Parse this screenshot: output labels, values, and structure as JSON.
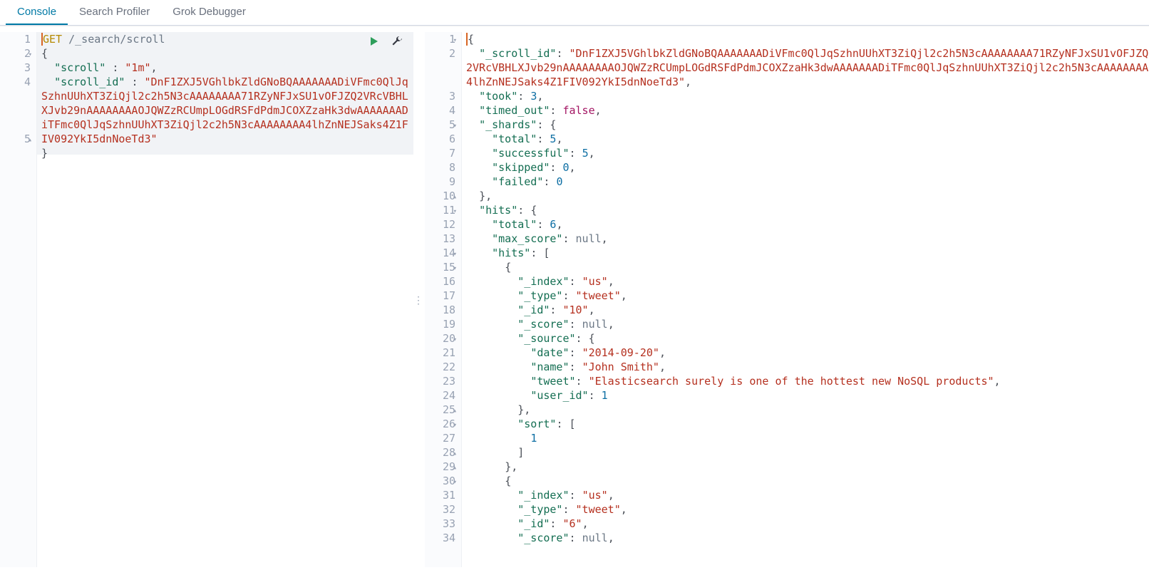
{
  "tabs": [
    {
      "label": "Console",
      "active": true
    },
    {
      "label": "Search Profiler",
      "active": false
    },
    {
      "label": "Grok Debugger",
      "active": false
    }
  ],
  "icons": {
    "play": "play-icon",
    "wrench": "wrench-icon",
    "resize": "resize-handle-icon"
  },
  "request": {
    "method": "GET",
    "path": "/_search/scroll",
    "body": {
      "scroll": "1m",
      "scroll_id": "DnF1ZXJ5VGhlbkZldGNoBQAAAAAAADiVFmc0QlJqSzhnUUhXT3ZiQjl2c2h5N3cAAAAAAAA71RZyNFJxSU1vOFJZQ2VRcVBHLXJvb29nAAAAAAAAOJQWZzRCUmpLOGdRSFdPdmJCOXZzaHk3dwAAAAAAADiTFmc0QlJqSzhnUUhXT3ZiQjl2c2h5N3cAAAAAAAA4lhZnNEJSaks4Z1FIV092YkI5dnNoeTd3"
    },
    "gutter": [
      {
        "n": "1",
        "fold": ""
      },
      {
        "n": "2",
        "fold": "▾"
      },
      {
        "n": "3",
        "fold": ""
      },
      {
        "n": "4",
        "fold": ""
      },
      {
        "n": "5",
        "fold": "▴"
      }
    ],
    "extra_line_slots": 3
  },
  "response": {
    "gutter": [
      {
        "n": "1",
        "fold": "▾"
      },
      {
        "n": "2",
        "fold": ""
      },
      {
        "n": "3",
        "fold": ""
      },
      {
        "n": "4",
        "fold": ""
      },
      {
        "n": "5",
        "fold": "▾"
      },
      {
        "n": "6",
        "fold": ""
      },
      {
        "n": "7",
        "fold": ""
      },
      {
        "n": "8",
        "fold": ""
      },
      {
        "n": "9",
        "fold": ""
      },
      {
        "n": "10",
        "fold": "▴"
      },
      {
        "n": "11",
        "fold": "▾"
      },
      {
        "n": "12",
        "fold": ""
      },
      {
        "n": "13",
        "fold": ""
      },
      {
        "n": "14",
        "fold": "▾"
      },
      {
        "n": "15",
        "fold": "▾"
      },
      {
        "n": "16",
        "fold": ""
      },
      {
        "n": "17",
        "fold": ""
      },
      {
        "n": "18",
        "fold": ""
      },
      {
        "n": "19",
        "fold": ""
      },
      {
        "n": "20",
        "fold": "▾"
      },
      {
        "n": "21",
        "fold": ""
      },
      {
        "n": "22",
        "fold": ""
      },
      {
        "n": "23",
        "fold": ""
      },
      {
        "n": "24",
        "fold": ""
      },
      {
        "n": "25",
        "fold": "▴"
      },
      {
        "n": "26",
        "fold": "▾"
      },
      {
        "n": "27",
        "fold": ""
      },
      {
        "n": "28",
        "fold": "▴"
      },
      {
        "n": "29",
        "fold": "▴"
      },
      {
        "n": "30",
        "fold": "▾"
      },
      {
        "n": "31",
        "fold": ""
      },
      {
        "n": "32",
        "fold": ""
      },
      {
        "n": "33",
        "fold": ""
      },
      {
        "n": "34",
        "fold": ""
      }
    ],
    "json": {
      "_scroll_id": "DnF1ZXJ5VGhlbkZldGNoBQAAAAAAADiVFmc0QlJqSzhnUUhXT3ZiQjl2c2h5N3cAAAAAAAA71RZyNFJxSU1vOFJZQ2VRcVBHLXJvb29nAAAAAAAAOJQWZzRCUmpLOGdRSFdPdmJCOXZzaHk3dwAAAAAAADiTFmc0QlJqSzhnUUhXT3ZiQjl2c2h5N3cAAAAAAAA4lhZnNEJSaks4Z1FIV092YkI5dnNoeTd3",
      "took": 3,
      "timed_out": false,
      "_shards": {
        "total": 5,
        "successful": 5,
        "skipped": 0,
        "failed": 0
      },
      "hits": {
        "total": 6,
        "max_score": null,
        "hits_preview": [
          {
            "_index": "us",
            "_type": "tweet",
            "_id": "10",
            "_score": null,
            "_source": {
              "date": "2014-09-20",
              "name": "John Smith",
              "tweet": "Elasticsearch surely is one of the hottest new NoSQL products",
              "user_id": 1
            },
            "sort": [
              1
            ]
          },
          {
            "_index": "us",
            "_type": "tweet",
            "_id": "6",
            "_score": null
          }
        ]
      }
    }
  }
}
